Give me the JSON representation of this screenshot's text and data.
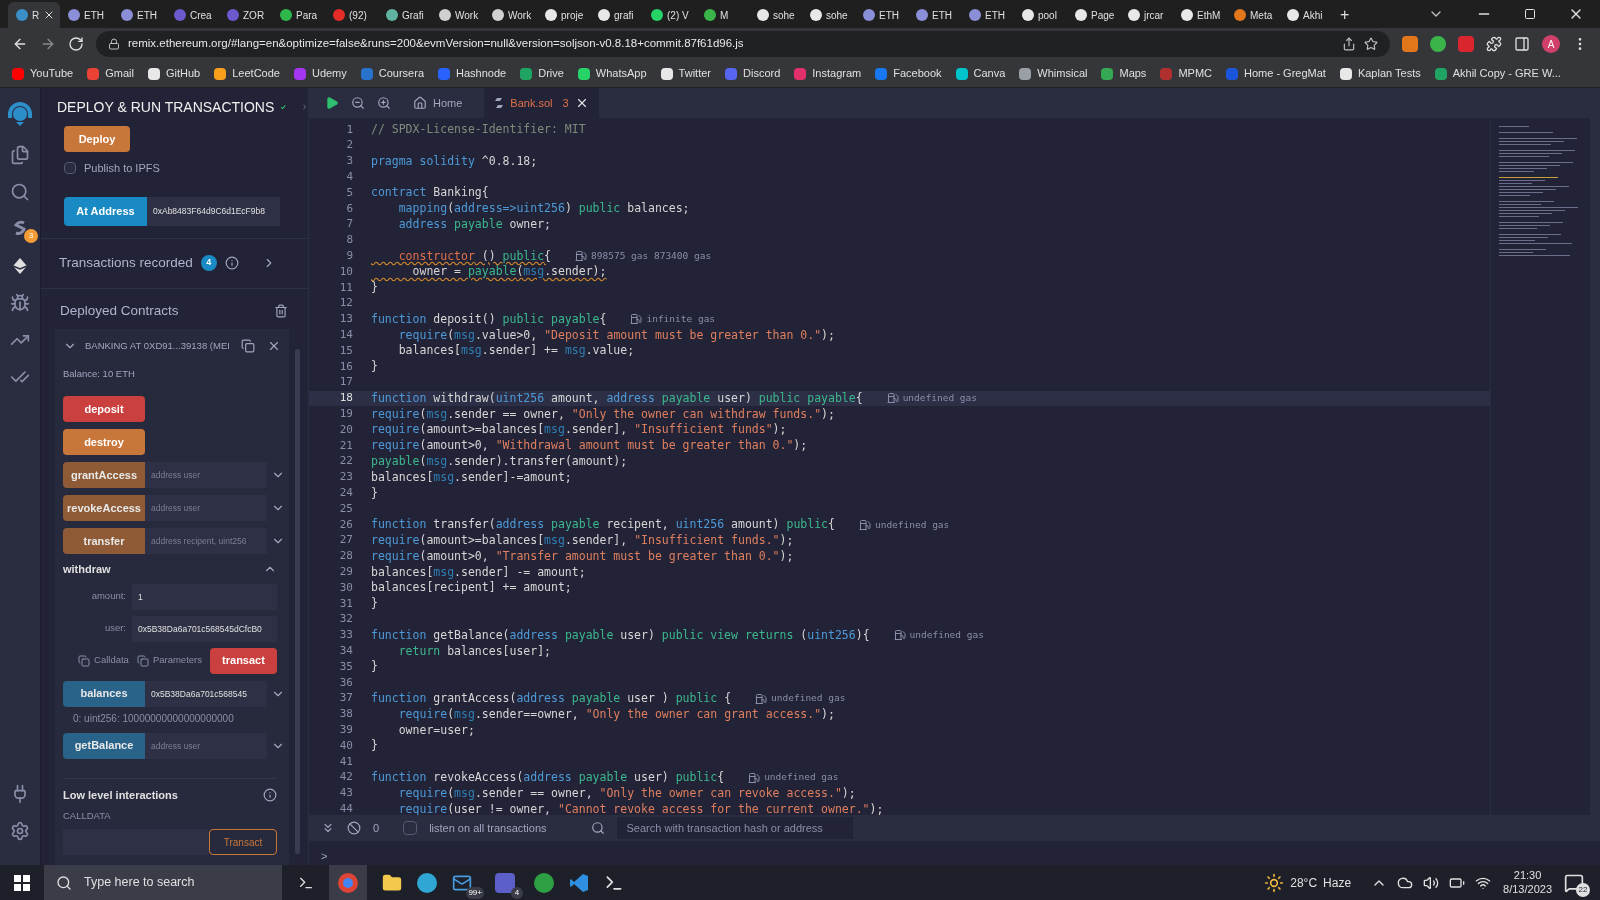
{
  "browser": {
    "tabs": [
      {
        "title": "R",
        "selected": true,
        "color": "#3a8fc7"
      },
      {
        "title": "ETH",
        "selected": false,
        "color": "#8b8fd8"
      },
      {
        "title": "ETH",
        "selected": false,
        "color": "#8b8fd8"
      },
      {
        "title": "Crea",
        "selected": false,
        "color": "#6a5acd"
      },
      {
        "title": "ZOR",
        "selected": false,
        "color": "#6a5acd"
      },
      {
        "title": "Para",
        "selected": false,
        "color": "#2eb84b"
      },
      {
        "title": "(92)",
        "selected": false,
        "color": "#e52d27"
      },
      {
        "title": "Grafi",
        "selected": false,
        "color": "#5fb3a0"
      },
      {
        "title": "Work",
        "selected": false,
        "color": "#d0d0d0"
      },
      {
        "title": "Work",
        "selected": false,
        "color": "#d0d0d0"
      },
      {
        "title": "proje",
        "selected": false,
        "color": "#e8e8e8"
      },
      {
        "title": "grafi",
        "selected": false,
        "color": "#e8e8e8"
      },
      {
        "title": "(2) V",
        "selected": false,
        "color": "#25d366"
      },
      {
        "title": "M",
        "selected": false,
        "color": "#3bb54a"
      },
      {
        "title": "sohe",
        "selected": false,
        "color": "#e8e8e8"
      },
      {
        "title": "sohe",
        "selected": false,
        "color": "#e8e8e8"
      },
      {
        "title": "ETH",
        "selected": false,
        "color": "#8b8fd8"
      },
      {
        "title": "ETH",
        "selected": false,
        "color": "#8b8fd8"
      },
      {
        "title": "ETH",
        "selected": false,
        "color": "#8b8fd8"
      },
      {
        "title": "pool",
        "selected": false,
        "color": "#e8e8e8"
      },
      {
        "title": "Page",
        "selected": false,
        "color": "#e8e8e8"
      },
      {
        "title": "jrcar",
        "selected": false,
        "color": "#e8e8e8"
      },
      {
        "title": "EthM",
        "selected": false,
        "color": "#e8e8e8"
      },
      {
        "title": "Meta",
        "selected": false,
        "color": "#e2761b"
      },
      {
        "title": "Akhi",
        "selected": false,
        "color": "#e8e8e8"
      }
    ],
    "new_tab": "+",
    "url": "remix.ethereum.org/#lang=en&optimize=false&runs=200&evmVersion=null&version=soljson-v0.8.18+commit.87f61d96.js",
    "profile": "A",
    "bookmarks": [
      {
        "label": "YouTube",
        "color": "#ff0000"
      },
      {
        "label": "Gmail",
        "color": "#ea4335"
      },
      {
        "label": "GitHub",
        "color": "#e8e8e8"
      },
      {
        "label": "LeetCode",
        "color": "#f89f1b"
      },
      {
        "label": "Udemy",
        "color": "#a435f0"
      },
      {
        "label": "Coursera",
        "color": "#2a73cc"
      },
      {
        "label": "Hashnode",
        "color": "#2962ff"
      },
      {
        "label": "Drive",
        "color": "#1fa463"
      },
      {
        "label": "WhatsApp",
        "color": "#25d366"
      },
      {
        "label": "Twitter",
        "color": "#e8e8e8"
      },
      {
        "label": "Discord",
        "color": "#5865f2"
      },
      {
        "label": "Instagram",
        "color": "#e1306c"
      },
      {
        "label": "Facebook",
        "color": "#1877f2"
      },
      {
        "label": "Canva",
        "color": "#00c4cc"
      },
      {
        "label": "Whimsical",
        "color": "#9aa0a6"
      },
      {
        "label": "Maps",
        "color": "#34a853"
      },
      {
        "label": "MPMC",
        "color": "#b03030"
      },
      {
        "label": "Home - GregMat",
        "color": "#1a56db"
      },
      {
        "label": "Kaplan Tests",
        "color": "#e8e8e8"
      },
      {
        "label": "Akhil Copy - GRE W...",
        "color": "#1fa463"
      }
    ]
  },
  "sidebar": {
    "plugin_badge": "3"
  },
  "panel": {
    "title": "DEPLOY & RUN TRANSACTIONS",
    "deploy_button": "Deploy",
    "publish": {
      "label": "Publish to IPFS",
      "checked": false
    },
    "at_address": {
      "button": "At Address",
      "value": "0xAb8483F64d9C6d1EcF9b8"
    },
    "transactions": {
      "label": "Transactions recorded",
      "count": "4"
    },
    "deployed": {
      "title": "Deployed Contracts",
      "contract": {
        "name": "BANKING AT 0XD91...39138 (MEI",
        "expanded": true,
        "balance": "Balance: 10 ETH",
        "functions": [
          {
            "kind": "button",
            "label": "deposit",
            "color": "#c9403e"
          },
          {
            "kind": "button",
            "label": "destroy",
            "color": "#c8763a"
          },
          {
            "kind": "input",
            "label": "grantAccess",
            "placeholder": "address user",
            "color": "#8e5b36"
          },
          {
            "kind": "input",
            "label": "revokeAccess",
            "placeholder": "address user",
            "color": "#8e5b36"
          },
          {
            "kind": "input",
            "label": "transfer",
            "placeholder": "address recipent, uint256",
            "color": "#8e5b36"
          },
          {
            "kind": "expanded",
            "label": "withdraw",
            "params": [
              {
                "label": "amount:",
                "value": "1"
              },
              {
                "label": "user:",
                "value": "0x5B38Da6a701c568545dCfcB0"
              }
            ],
            "calldata": "Calldata",
            "parameters": "Parameters",
            "transact": "transact",
            "color": "#c9403e"
          },
          {
            "kind": "input",
            "label": "balances",
            "value": "0x5B38Da6a701c568545",
            "result": "0: uint256: 10000000000000000000",
            "color": "#2a6389"
          },
          {
            "kind": "input",
            "label": "getBalance",
            "placeholder": "address user",
            "color": "#2a6389"
          }
        ]
      }
    },
    "low_level": {
      "title": "Low level interactions",
      "label": "CALLDATA",
      "button": "Transact"
    }
  },
  "editor": {
    "tabs": [
      {
        "label": "Home",
        "kind": "home",
        "selected": false
      },
      {
        "label": "Bank.sol",
        "kind": "file",
        "count": "3",
        "selected": true
      }
    ],
    "lines": [
      {
        "number": "1",
        "current": false,
        "warning": false,
        "tokens": [
          {
            "kind": "comment",
            "text": "// SPDX-License-Identifier: MIT"
          }
        ]
      },
      {
        "number": "2",
        "current": false
      },
      {
        "number": "3",
        "current": false,
        "warning": false,
        "tokens": [
          {
            "kind": "keyword",
            "text": "pragma solidity"
          },
          {
            "kind": "plain",
            "text": " ^0.8.18;"
          }
        ]
      },
      {
        "number": "4",
        "current": false
      },
      {
        "number": "5",
        "current": false,
        "warning": false,
        "tokens": [
          {
            "kind": "keyword",
            "text": "contract"
          },
          {
            "kind": "plain",
            "text": " Banking{"
          }
        ]
      },
      {
        "number": "6",
        "current": false,
        "warning": false,
        "tokens": [
          {
            "kind": "keyword",
            "text": "    mapping"
          },
          {
            "kind": "plain",
            "text": "("
          },
          {
            "kind": "keyword",
            "text": "address=>uint256"
          },
          {
            "kind": "plain",
            "text": ") "
          },
          {
            "kind": "modifier",
            "text": "public"
          },
          {
            "kind": "plain",
            "text": " balances;"
          }
        ]
      },
      {
        "number": "7",
        "current": false,
        "warning": false,
        "tokens": [
          {
            "kind": "keyword",
            "text": "    address"
          },
          {
            "kind": "modifier",
            "text": " payable"
          },
          {
            "kind": "plain",
            "text": " owner;"
          }
        ]
      },
      {
        "number": "8",
        "current": false
      },
      {
        "number": "9",
        "current": false,
        "warning": true,
        "tokens": [
          {
            "kind": "error",
            "text": "    constructor"
          },
          {
            "kind": "plain",
            "text": " () "
          },
          {
            "kind": "modifier",
            "text": "public"
          },
          {
            "kind": "plain",
            "text": "{"
          }
        ],
        "gas": "898575 gas 873400 gas"
      },
      {
        "number": "10",
        "current": false,
        "warning": true,
        "tokens": [
          {
            "kind": "plain",
            "text": "      owner = "
          },
          {
            "kind": "modifier",
            "text": "payable"
          },
          {
            "kind": "plain",
            "text": "("
          },
          {
            "kind": "builtin",
            "text": "msg"
          },
          {
            "kind": "plain",
            "text": ".sender);"
          }
        ]
      },
      {
        "number": "11",
        "current": false,
        "warning": false,
        "tokens": [
          {
            "kind": "plain",
            "text": "}"
          }
        ]
      },
      {
        "number": "12",
        "current": false
      },
      {
        "number": "13",
        "current": false,
        "warning": false,
        "tokens": [
          {
            "kind": "keyword",
            "text": "function"
          },
          {
            "kind": "plain",
            "text": " deposit() "
          },
          {
            "kind": "modifier",
            "text": "public payable"
          },
          {
            "kind": "plain",
            "text": "{"
          }
        ],
        "gas": "infinite gas"
      },
      {
        "number": "14",
        "current": false,
        "warning": false,
        "tokens": [
          {
            "kind": "keyword",
            "text": "    require"
          },
          {
            "kind": "plain",
            "text": "("
          },
          {
            "kind": "builtin",
            "text": "msg"
          },
          {
            "kind": "plain",
            "text": ".value>0, "
          },
          {
            "kind": "string",
            "text": "\"Deposit amount must be greater than 0.\""
          },
          {
            "kind": "plain",
            "text": ");"
          }
        ]
      },
      {
        "number": "15",
        "current": false,
        "warning": false,
        "tokens": [
          {
            "kind": "plain",
            "text": "    balances["
          },
          {
            "kind": "builtin",
            "text": "msg"
          },
          {
            "kind": "plain",
            "text": ".sender] += "
          },
          {
            "kind": "builtin",
            "text": "msg"
          },
          {
            "kind": "plain",
            "text": ".value;"
          }
        ]
      },
      {
        "number": "16",
        "current": false,
        "warning": false,
        "tokens": [
          {
            "kind": "plain",
            "text": "}"
          }
        ]
      },
      {
        "number": "17",
        "current": false
      },
      {
        "number": "18",
        "current": true,
        "warning": false,
        "tokens": [
          {
            "kind": "keyword",
            "text": "function"
          },
          {
            "kind": "plain",
            "text": " withdraw("
          },
          {
            "kind": "keyword",
            "text": "uint256"
          },
          {
            "kind": "plain",
            "text": " amount, "
          },
          {
            "kind": "keyword",
            "text": "address"
          },
          {
            "kind": "modifier",
            "text": " payable"
          },
          {
            "kind": "plain",
            "text": " user) "
          },
          {
            "kind": "modifier",
            "text": "public payable"
          },
          {
            "kind": "plain",
            "text": "{"
          }
        ],
        "gas": "undefined gas"
      },
      {
        "number": "19",
        "current": false,
        "warning": false,
        "tokens": [
          {
            "kind": "keyword",
            "text": "require"
          },
          {
            "kind": "plain",
            "text": "("
          },
          {
            "kind": "builtin",
            "text": "msg"
          },
          {
            "kind": "plain",
            "text": ".sender == owner, "
          },
          {
            "kind": "string",
            "text": "\"Only the owner can withdraw funds.\""
          },
          {
            "kind": "plain",
            "text": ");"
          }
        ]
      },
      {
        "number": "20",
        "current": false,
        "warning": false,
        "tokens": [
          {
            "kind": "keyword",
            "text": "require"
          },
          {
            "kind": "plain",
            "text": "(amount>=balances["
          },
          {
            "kind": "builtin",
            "text": "msg"
          },
          {
            "kind": "plain",
            "text": ".sender], "
          },
          {
            "kind": "string",
            "text": "\"Insufficient funds\""
          },
          {
            "kind": "plain",
            "text": ");"
          }
        ]
      },
      {
        "number": "21",
        "current": false,
        "warning": false,
        "tokens": [
          {
            "kind": "keyword",
            "text": "require"
          },
          {
            "kind": "plain",
            "text": "(amount>0, "
          },
          {
            "kind": "string",
            "text": "\"Withdrawal amount must be greater than 0.\""
          },
          {
            "kind": "plain",
            "text": ");"
          }
        ]
      },
      {
        "number": "22",
        "current": false,
        "warning": false,
        "tokens": [
          {
            "kind": "modifier",
            "text": "payable"
          },
          {
            "kind": "plain",
            "text": "("
          },
          {
            "kind": "builtin",
            "text": "msg"
          },
          {
            "kind": "plain",
            "text": ".sender).transfer(amount);"
          }
        ]
      },
      {
        "number": "23",
        "current": false,
        "warning": false,
        "tokens": [
          {
            "kind": "plain",
            "text": "balances["
          },
          {
            "kind": "builtin",
            "text": "msg"
          },
          {
            "kind": "plain",
            "text": ".sender]-=amount;"
          }
        ]
      },
      {
        "number": "24",
        "current": false,
        "warning": false,
        "tokens": [
          {
            "kind": "plain",
            "text": "}"
          }
        ]
      },
      {
        "number": "25",
        "current": false
      },
      {
        "number": "26",
        "current": false,
        "warning": false,
        "tokens": [
          {
            "kind": "keyword",
            "text": "function"
          },
          {
            "kind": "plain",
            "text": " transfer("
          },
          {
            "kind": "keyword",
            "text": "address"
          },
          {
            "kind": "modifier",
            "text": " payable"
          },
          {
            "kind": "plain",
            "text": " recipent, "
          },
          {
            "kind": "keyword",
            "text": "uint256"
          },
          {
            "kind": "plain",
            "text": " amount) "
          },
          {
            "kind": "modifier",
            "text": "public"
          },
          {
            "kind": "plain",
            "text": "{"
          }
        ],
        "gas": "undefined gas"
      },
      {
        "number": "27",
        "current": false,
        "warning": false,
        "tokens": [
          {
            "kind": "keyword",
            "text": "require"
          },
          {
            "kind": "plain",
            "text": "(amount>=balances["
          },
          {
            "kind": "builtin",
            "text": "msg"
          },
          {
            "kind": "plain",
            "text": ".sender], "
          },
          {
            "kind": "string",
            "text": "\"Insufficient funds.\""
          },
          {
            "kind": "plain",
            "text": ");"
          }
        ]
      },
      {
        "number": "28",
        "current": false,
        "warning": false,
        "tokens": [
          {
            "kind": "keyword",
            "text": "require"
          },
          {
            "kind": "plain",
            "text": "(amount>0, "
          },
          {
            "kind": "string",
            "text": "\"Transfer amount must be greater than 0.\""
          },
          {
            "kind": "plain",
            "text": ");"
          }
        ]
      },
      {
        "number": "29",
        "current": false,
        "warning": false,
        "tokens": [
          {
            "kind": "plain",
            "text": "balances["
          },
          {
            "kind": "builtin",
            "text": "msg"
          },
          {
            "kind": "plain",
            "text": ".sender] -= amount;"
          }
        ]
      },
      {
        "number": "30",
        "current": false,
        "warning": false,
        "tokens": [
          {
            "kind": "plain",
            "text": "balances[recipent] += amount;"
          }
        ]
      },
      {
        "number": "31",
        "current": false,
        "warning": false,
        "tokens": [
          {
            "kind": "plain",
            "text": "}"
          }
        ]
      },
      {
        "number": "32",
        "current": false
      },
      {
        "number": "33",
        "current": false,
        "warning": false,
        "tokens": [
          {
            "kind": "keyword",
            "text": "function"
          },
          {
            "kind": "plain",
            "text": " getBalance("
          },
          {
            "kind": "keyword",
            "text": "address"
          },
          {
            "kind": "modifier",
            "text": " payable"
          },
          {
            "kind": "plain",
            "text": " user) "
          },
          {
            "kind": "modifier",
            "text": "public view returns"
          },
          {
            "kind": "plain",
            "text": " ("
          },
          {
            "kind": "keyword",
            "text": "uint256"
          },
          {
            "kind": "plain",
            "text": "){"
          }
        ],
        "gas": "undefined gas"
      },
      {
        "number": "34",
        "current": false,
        "warning": false,
        "tokens": [
          {
            "kind": "modifier",
            "text": "    return"
          },
          {
            "kind": "plain",
            "text": " balances[user];"
          }
        ]
      },
      {
        "number": "35",
        "current": false,
        "warning": false,
        "tokens": [
          {
            "kind": "plain",
            "text": "}"
          }
        ]
      },
      {
        "number": "36",
        "current": false
      },
      {
        "number": "37",
        "current": false,
        "warning": false,
        "tokens": [
          {
            "kind": "keyword",
            "text": "function"
          },
          {
            "kind": "plain",
            "text": " grantAccess("
          },
          {
            "kind": "keyword",
            "text": "address"
          },
          {
            "kind": "modifier",
            "text": " payable"
          },
          {
            "kind": "plain",
            "text": " user ) "
          },
          {
            "kind": "modifier",
            "text": "public"
          },
          {
            "kind": "plain",
            "text": " {"
          }
        ],
        "gas": "undefined gas"
      },
      {
        "number": "38",
        "current": false,
        "warning": false,
        "tokens": [
          {
            "kind": "keyword",
            "text": "    require"
          },
          {
            "kind": "plain",
            "text": "("
          },
          {
            "kind": "builtin",
            "text": "msg"
          },
          {
            "kind": "plain",
            "text": ".sender==owner, "
          },
          {
            "kind": "string",
            "text": "\"Only the owner can grant access.\""
          },
          {
            "kind": "plain",
            "text": ");"
          }
        ]
      },
      {
        "number": "39",
        "current": false,
        "warning": false,
        "tokens": [
          {
            "kind": "plain",
            "text": "    owner=user;"
          }
        ]
      },
      {
        "number": "40",
        "current": false,
        "warning": false,
        "tokens": [
          {
            "kind": "plain",
            "text": "}"
          }
        ]
      },
      {
        "number": "41",
        "current": false
      },
      {
        "number": "42",
        "current": false,
        "warning": false,
        "tokens": [
          {
            "kind": "keyword",
            "text": "function"
          },
          {
            "kind": "plain",
            "text": " revokeAccess("
          },
          {
            "kind": "keyword",
            "text": "address"
          },
          {
            "kind": "modifier",
            "text": " payable"
          },
          {
            "kind": "plain",
            "text": " user) "
          },
          {
            "kind": "modifier",
            "text": "public"
          },
          {
            "kind": "plain",
            "text": "{"
          }
        ],
        "gas": "undefined gas"
      },
      {
        "number": "43",
        "current": false,
        "warning": false,
        "tokens": [
          {
            "kind": "keyword",
            "text": "    require"
          },
          {
            "kind": "plain",
            "text": "("
          },
          {
            "kind": "builtin",
            "text": "msg"
          },
          {
            "kind": "plain",
            "text": ".sender == owner, "
          },
          {
            "kind": "string",
            "text": "\"Only the owner can revoke access.\""
          },
          {
            "kind": "plain",
            "text": ");"
          }
        ]
      },
      {
        "number": "44",
        "current": false,
        "warning": false,
        "tokens": [
          {
            "kind": "keyword",
            "text": "    require"
          },
          {
            "kind": "plain",
            "text": "(user != owner, "
          },
          {
            "kind": "string",
            "text": "\"Cannot revoke access for the current owner.\""
          },
          {
            "kind": "plain",
            "text": ");"
          }
        ]
      }
    ]
  },
  "terminal": {
    "count": "0",
    "listen": {
      "label": "listen on all transactions",
      "checked": false
    },
    "search_placeholder": "Search with transaction hash or address",
    "prompt": ">"
  },
  "taskbar": {
    "search_placeholder": "Type here to search",
    "mail_badge": "99+",
    "app_badge": "4",
    "temperature": "28°C",
    "weather": "Haze",
    "time": "21:30",
    "date": "8/13/2023",
    "notifications": "22"
  }
}
